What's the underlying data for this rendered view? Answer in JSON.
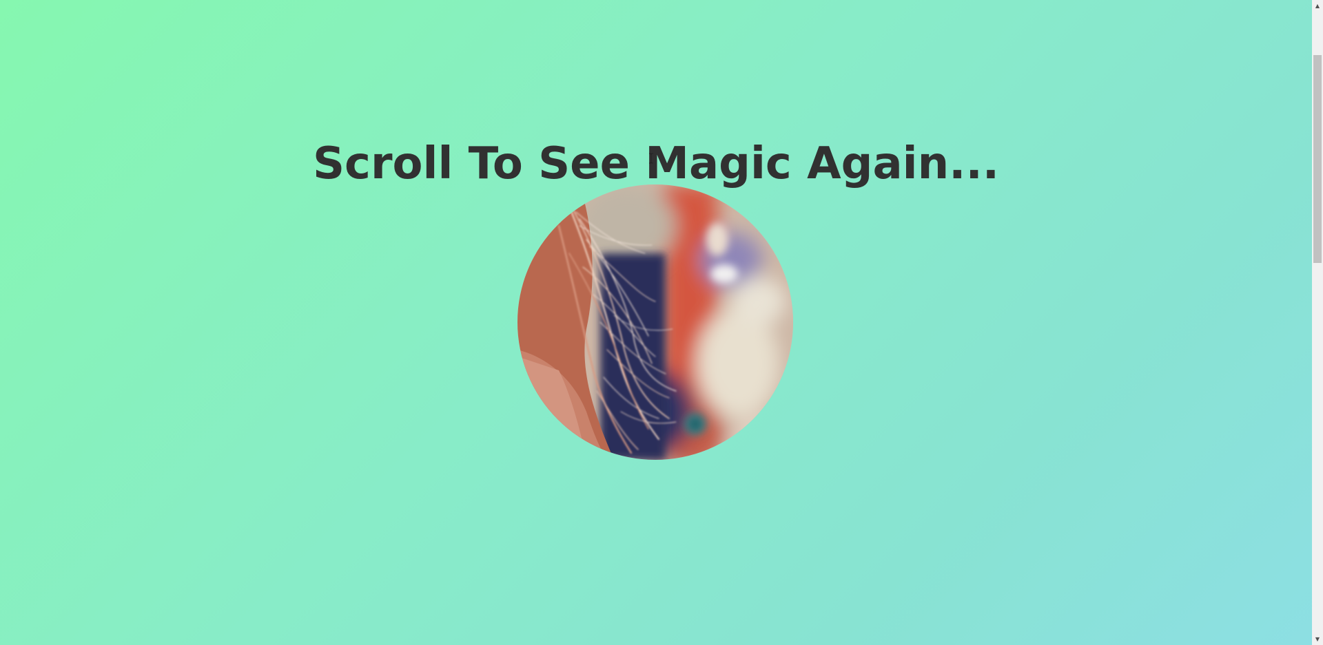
{
  "hero": {
    "title": "Scroll To See Magic Again...",
    "image_icon": "hair-closeup-photo"
  },
  "scrollbar": {
    "up_arrow_icon": "triangle-up-icon",
    "down_arrow_icon": "triangle-down-icon",
    "up_glyph": "▲",
    "down_glyph": "▼"
  },
  "colors": {
    "background_start": "#86f7b0",
    "background_end": "#8ddfe3",
    "title_color": "#313131"
  }
}
